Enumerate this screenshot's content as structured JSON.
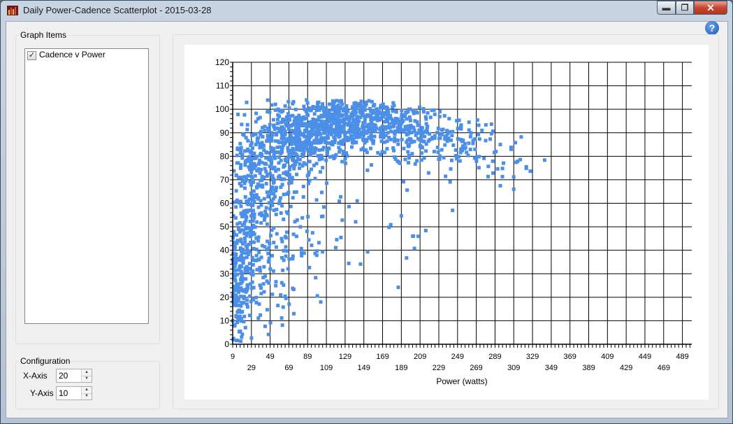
{
  "window": {
    "title": "Daily Power-Cadence Scatterplot - 2015-03-28",
    "controls": {
      "minimize": "▬",
      "maximize": "❐",
      "close": "✕"
    },
    "icon": "bar-chart-app-icon"
  },
  "help": {
    "glyph": "?"
  },
  "graph_items": {
    "label": "Graph Items",
    "items": [
      {
        "label": "Cadence v Power",
        "checked": true
      }
    ]
  },
  "configuration": {
    "label": "Configuration",
    "x_axis": {
      "label": "X-Axis",
      "value": "20"
    },
    "y_axis": {
      "label": "Y-Axis",
      "value": "10"
    }
  },
  "colors": {
    "points": "#4b8fe8",
    "grid": "#000000",
    "background": "#ffffff"
  },
  "chart_data": {
    "type": "scatter",
    "xlabel": "Power (watts)",
    "ylabel": "",
    "xlim": [
      9,
      499
    ],
    "ylim": [
      0,
      120
    ],
    "x_ticks": [
      9,
      29,
      49,
      69,
      89,
      109,
      129,
      149,
      169,
      189,
      209,
      229,
      249,
      269,
      289,
      309,
      329,
      349,
      369,
      389,
      409,
      429,
      449,
      469,
      489
    ],
    "y_ticks": [
      0,
      10,
      20,
      30,
      40,
      50,
      60,
      70,
      80,
      90,
      100,
      110,
      120
    ],
    "grid": true,
    "series": [
      {
        "color": "#4b8fe8",
        "clusters": [
          {
            "x": 12,
            "y": 15,
            "n": 120,
            "sx": 5,
            "sy": 14
          },
          {
            "x": 20,
            "y": 40,
            "n": 160,
            "sx": 10,
            "sy": 18
          },
          {
            "x": 30,
            "y": 62,
            "n": 150,
            "sx": 14,
            "sy": 14
          },
          {
            "x": 50,
            "y": 78,
            "n": 200,
            "sx": 18,
            "sy": 10
          },
          {
            "x": 80,
            "y": 88,
            "n": 320,
            "sx": 22,
            "sy": 7
          },
          {
            "x": 115,
            "y": 94,
            "n": 320,
            "sx": 22,
            "sy": 6
          },
          {
            "x": 155,
            "y": 94,
            "n": 220,
            "sx": 22,
            "sy": 5
          },
          {
            "x": 200,
            "y": 90,
            "n": 150,
            "sx": 22,
            "sy": 6
          },
          {
            "x": 250,
            "y": 85,
            "n": 80,
            "sx": 20,
            "sy": 6
          },
          {
            "x": 300,
            "y": 78,
            "n": 30,
            "sx": 25,
            "sy": 6
          },
          {
            "x": 60,
            "y": 45,
            "n": 70,
            "sx": 22,
            "sy": 15
          },
          {
            "x": 110,
            "y": 52,
            "n": 35,
            "sx": 35,
            "sy": 14
          },
          {
            "x": 200,
            "y": 52,
            "n": 16,
            "sx": 35,
            "sy": 12
          },
          {
            "x": 35,
            "y": 25,
            "n": 50,
            "sx": 18,
            "sy": 12
          }
        ]
      }
    ]
  }
}
